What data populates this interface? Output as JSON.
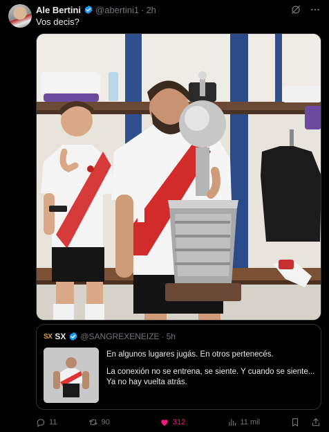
{
  "tweet": {
    "author_name": "Ale Bertini",
    "handle": "@abertini1",
    "separator": "·",
    "time": "2h",
    "text": "Vos decis?"
  },
  "quote": {
    "logo": "SX",
    "author_name": "SX",
    "handle": "@SANGREXENEIZE",
    "separator": "·",
    "time": "5h",
    "paragraphs": [
      "En algunos lugares jugás. En otros pertenecés.",
      "La conexión no se entrena, se siente. Y cuando se siente... Ya no hay vuelta atrás."
    ]
  },
  "actions": {
    "replies": "11",
    "retweets": "90",
    "likes": "312",
    "views": "11 mil"
  },
  "icons": {
    "verified": "verified-badge-icon",
    "grok": "grok-icon",
    "more": "more-icon",
    "reply": "reply-icon",
    "retweet": "retweet-icon",
    "like": "heart-icon",
    "views": "views-icon",
    "bookmark": "bookmark-icon",
    "share": "share-icon"
  },
  "colors": {
    "background": "#000000",
    "text": "#e7e9ea",
    "muted": "#71767b",
    "border": "#2f3336",
    "verified": "#1d9bf0",
    "like_active": "#f91880"
  }
}
